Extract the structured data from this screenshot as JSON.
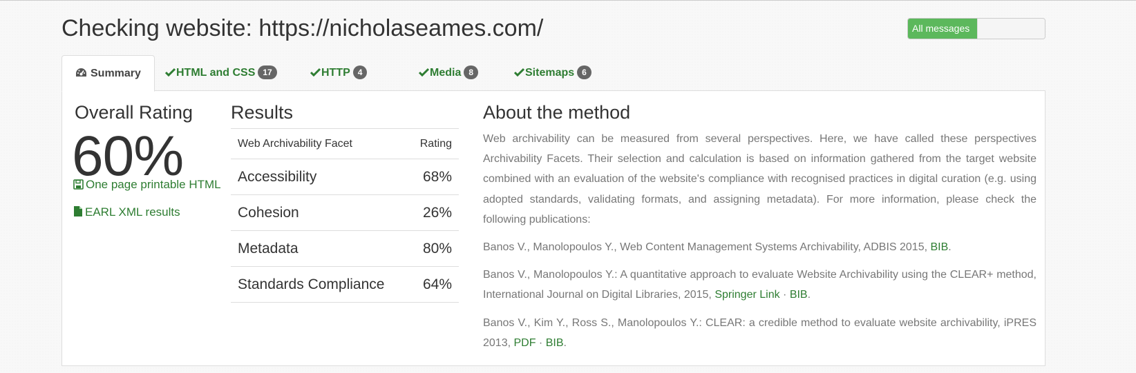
{
  "header": {
    "title": "Checking website: https://nicholaseames.com/",
    "toggle_label": "All messages"
  },
  "tabs": [
    {
      "label": "Summary",
      "icon": "dashboard-icon",
      "active": true
    },
    {
      "label": "HTML and CSS",
      "icon": "check-icon",
      "count": "17"
    },
    {
      "label": "HTTP",
      "icon": "check-icon",
      "count": "4"
    },
    {
      "label": "Media",
      "icon": "check-icon",
      "count": "8"
    },
    {
      "label": "Sitemaps",
      "icon": "check-icon",
      "count": "6"
    }
  ],
  "overall": {
    "title": "Overall Rating",
    "value": "60%",
    "printable_link": "One page printable HTML",
    "earl_link": "EARL XML results"
  },
  "results": {
    "title": "Results",
    "headers": [
      "Web Archivability Facet",
      "Rating"
    ],
    "rows": [
      {
        "facet": "Accessibility",
        "rating": "68%"
      },
      {
        "facet": "Cohesion",
        "rating": "26%"
      },
      {
        "facet": "Metadata",
        "rating": "80%"
      },
      {
        "facet": "Standards Compliance",
        "rating": "64%"
      }
    ]
  },
  "about": {
    "title": "About the method",
    "intro": "Web archivability can be measured from several perspectives. Here, we have called these perspectives Archivability Facets. Their selection and calculation is based on information gathered from the target website combined with an evaluation of the website's compliance with recognised practices in digital curation (e.g. using adopted standards, validating formats, and assigning metadata). For more information, please check the following publications:",
    "pub1": {
      "text": "Banos V., Manolopoulos Y., Web Content Management Systems Archivability, ADBIS 2015, ",
      "bib": "BIB",
      "end": "."
    },
    "pub2": {
      "text": "Banos V., Manolopoulos Y.: A quantitative approach to evaluate Website Archivability using the CLEAR+ method, International Journal on Digital Libraries, 2015, ",
      "springer": "Springer Link",
      "sep": " · ",
      "bib": "BIB",
      "end": "."
    },
    "pub3": {
      "text": "Banos V., Kim Y., Ross S., Manolopoulos Y.: CLEAR: a credible method to evaluate website archivability, iPRES 2013, ",
      "pdf": "PDF",
      "sep": " · ",
      "bib": "BIB",
      "end": "."
    }
  },
  "colors": {
    "accent": "#2e7d32",
    "toggle_on": "#5cb85c",
    "badge": "#666666"
  }
}
